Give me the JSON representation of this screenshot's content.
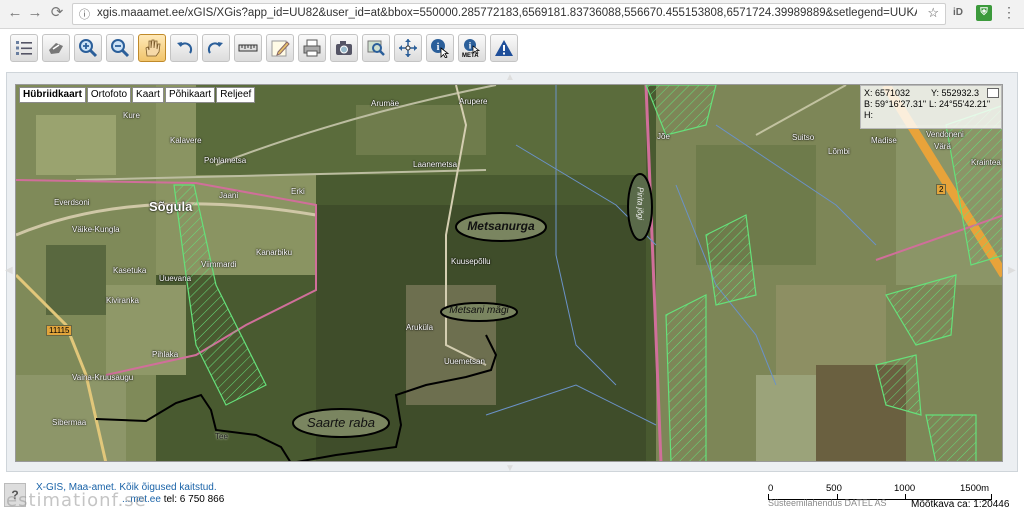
{
  "browser": {
    "url": "xgis.maaamet.ee/xGIS/XGis?app_id=UU82&user_id=at&bbox=550000.285772183,6569181.83736088,556670.455153808,6571724.39989889&setlegend=UUKAT1_82=0",
    "ext1": "iD"
  },
  "toolbar": {
    "buttons": [
      "layers-icon",
      "pan-hand-icon",
      "zoom-in-icon",
      "zoom-out-icon",
      "hand-icon",
      "undo-icon",
      "redo-icon",
      "measure-icon",
      "edit-icon",
      "print-icon",
      "camera-icon",
      "search-map-icon",
      "extent-icon",
      "info-icon",
      "meta-info-icon",
      "warning-icon"
    ],
    "meta_label": "META"
  },
  "map": {
    "tabs": [
      "Hübriidkaart",
      "Ortofoto",
      "Kaart",
      "Põhikaart",
      "Reljeef"
    ],
    "active_tab": "Hübriidkaart",
    "coords": {
      "x": "X: 6571032",
      "y": "Y: 552932.3",
      "b": "B: 59°16'27.31\"",
      "l": "L: 24°55'42.21\"",
      "h": "H:"
    },
    "labels": [
      "Arumäe",
      "Arupere",
      "Kure",
      "Kalavere",
      "Pohlametsa",
      "Jaani",
      "Erki",
      "Laanemetsa",
      "Everdsoni",
      "Väike-Kungla",
      "Kasetuka",
      "Kiviranka",
      "Vaina-Kruusaugu",
      "Pihlaka",
      "Sibermaa",
      "Viimmardi",
      "Kanarbiku",
      "Uuevana",
      "Kuusepõllu",
      "Aruküla",
      "Uuemetsan",
      "Tee",
      "Suitso",
      "Lõmbi",
      "Madise",
      "Vendoneni",
      "Värä",
      "Kraintea",
      "Jõe",
      "Kesasoo"
    ],
    "village": "Sõgula",
    "ellipses": [
      "Metsanurga",
      "Metsani mägi",
      "Saarte raba",
      "Pirita jõgi"
    ],
    "road_sign": "11115",
    "road_sign_2": "2"
  },
  "footer": {
    "copyright": "X-GIS, Maa-amet. Kõik õigused kaitstud.",
    "contact_prefix": "",
    "contact_link": "...met.ee",
    "contact_tel": "tel: 6 750 866",
    "watermark": "estimationf.se",
    "scale_labels": [
      "0",
      "500",
      "1000",
      "1500m"
    ],
    "scale_credit": "Süsteemilahendus DATEL AS",
    "scale_ratio": "Mõõtkava ca: 1:20446"
  }
}
